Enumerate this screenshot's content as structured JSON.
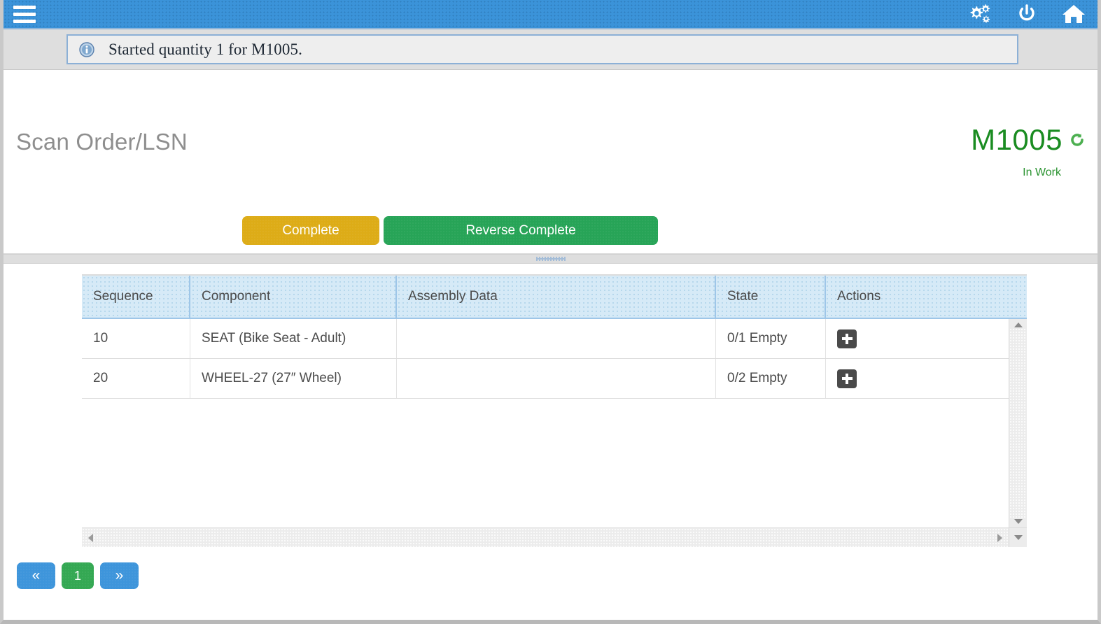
{
  "topbar": {
    "menu_label": "menu",
    "icons": [
      {
        "name": "settings-gears-icon",
        "label": "Settings"
      },
      {
        "name": "power-icon",
        "label": "Log Off"
      },
      {
        "name": "home-icon",
        "label": "Home"
      }
    ]
  },
  "message": {
    "icon": "info-icon",
    "text": "Started quantity 1 for M1005."
  },
  "header": {
    "title": "Scan Order/LSN",
    "status_id": "M1005",
    "status_text": "In Work",
    "refresh_icon": "refresh-icon"
  },
  "actions": {
    "complete_label": "Complete",
    "reverse_complete_label": "Reverse Complete",
    "complete_color": "#ddac17",
    "reverse_color": "#27a457"
  },
  "table": {
    "columns": [
      "Sequence",
      "Component",
      "Assembly Data",
      "State",
      "Actions"
    ],
    "rows": [
      {
        "sequence": "10",
        "component": "SEAT (Bike Seat - Adult)",
        "assembly_data": "",
        "state": "0/1  Empty",
        "action_icon": "plus-icon"
      },
      {
        "sequence": "20",
        "component": "WHEEL-27 (27″ Wheel)",
        "assembly_data": "",
        "state": "0/2  Empty",
        "action_icon": "plus-icon"
      }
    ]
  },
  "pagination": {
    "first_label": "«",
    "current_page": "1",
    "next_label": "»",
    "current_color": "#34a853",
    "nav_color": "#3e95db"
  }
}
